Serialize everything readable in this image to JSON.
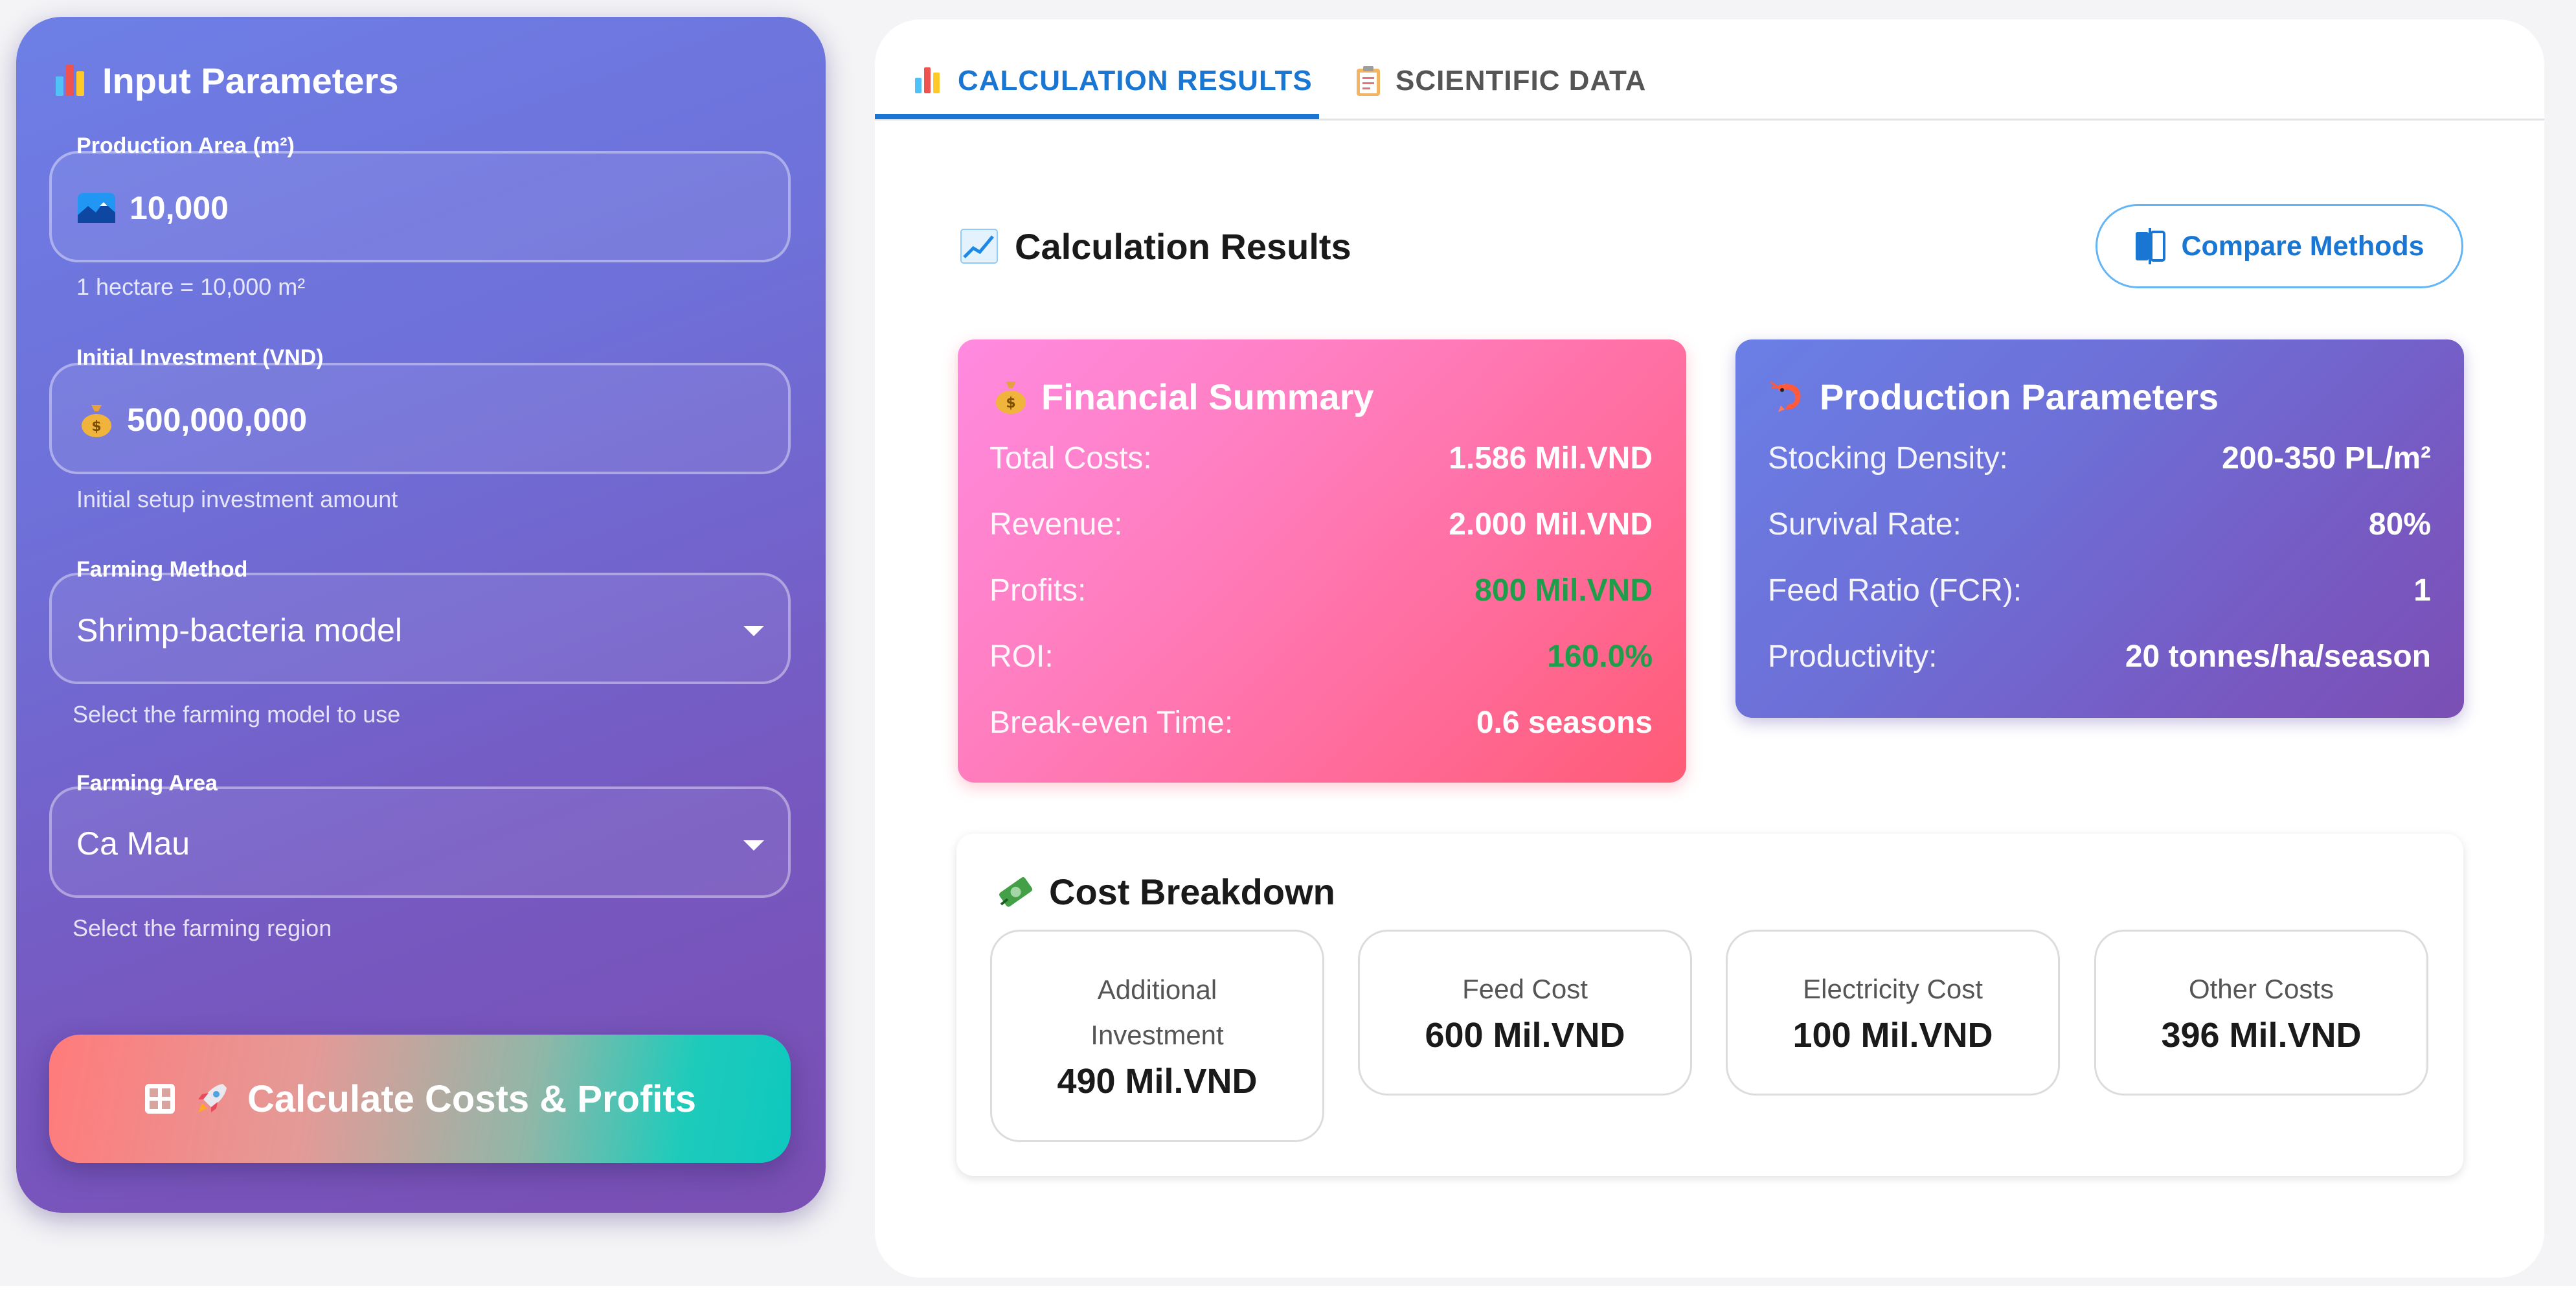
{
  "input_panel": {
    "title": "Input Parameters",
    "production_area": {
      "legend": "Production Area (m²)",
      "value": "10,000",
      "helper": "1 hectare = 10,000 m²"
    },
    "initial_investment": {
      "legend": "Initial Investment (VND)",
      "value": "500,000,000",
      "helper": "Initial setup investment amount"
    },
    "farming_method": {
      "legend": "Farming Method",
      "value": "Shrimp-bacteria model",
      "helper": "Select the farming model to use"
    },
    "farming_area": {
      "legend": "Farming Area",
      "value": "Ca Mau",
      "helper": "Select the farming region"
    },
    "calculate_label": "Calculate Costs & Profits"
  },
  "tabs": [
    {
      "label": "CALCULATION RESULTS",
      "active": true
    },
    {
      "label": "SCIENTIFIC DATA",
      "active": false
    }
  ],
  "results": {
    "title": "Calculation Results",
    "compare_label": "Compare Methods"
  },
  "financial_summary": {
    "title": "Financial Summary",
    "rows": [
      {
        "label": "Total Costs:",
        "value": "1.586 Mil.VND"
      },
      {
        "label": "Revenue:",
        "value": "2.000 Mil.VND"
      },
      {
        "label": "Profits:",
        "value": "800 Mil.VND"
      },
      {
        "label": "ROI:",
        "value": "160.0%"
      },
      {
        "label": "Break-even Time:",
        "value": "0.6 seasons"
      }
    ]
  },
  "production_parameters": {
    "title": "Production Parameters",
    "rows": [
      {
        "label": "Stocking Density:",
        "value": "200-350 PL/m²"
      },
      {
        "label": "Survival Rate:",
        "value": "80%"
      },
      {
        "label": "Feed Ratio (FCR):",
        "value": "1"
      },
      {
        "label": "Productivity:",
        "value": "20 tonnes/ha/season"
      }
    ]
  },
  "cost_breakdown": {
    "title": "Cost Breakdown",
    "items": [
      {
        "label_line1": "Additional",
        "label_line2": "Investment",
        "value": "490 Mil.VND"
      },
      {
        "label_line1": "Feed Cost",
        "value": "600 Mil.VND"
      },
      {
        "label_line1": "Electricity Cost",
        "value": "100 Mil.VND"
      },
      {
        "label_line1": "Other Costs",
        "value": "396 Mil.VND"
      }
    ]
  },
  "colors": {
    "accent": "#1976d2",
    "profit_green": "#1e9e4a"
  }
}
